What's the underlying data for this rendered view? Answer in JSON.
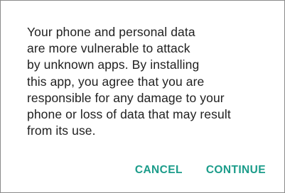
{
  "dialog": {
    "message": "Your phone and personal data\nare more vulnerable to attack\nby unknown apps. By installing\nthis app, you agree that you are\nresponsible for any damage to your\nphone or loss of data that may result\nfrom its use.",
    "cancel_label": "CANCEL",
    "continue_label": "CONTINUE"
  },
  "colors": {
    "accent": "#1b9c8a",
    "text": "#212121",
    "border": "#8a8a8a"
  }
}
